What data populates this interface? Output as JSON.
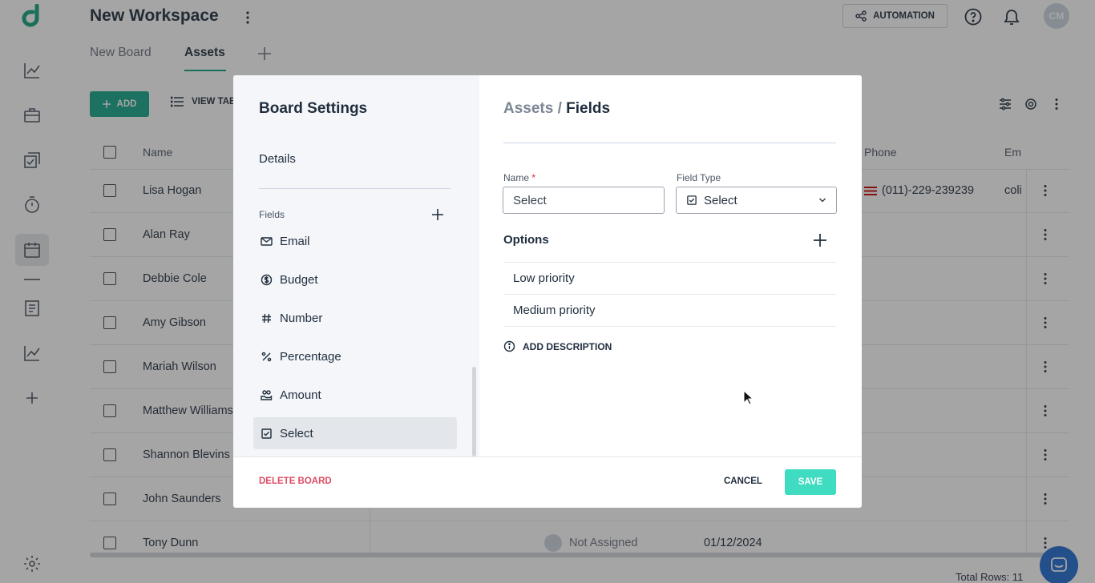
{
  "header": {
    "workspace_title": "New Workspace",
    "automation_label": "AUTOMATION",
    "avatar_initials": "CM"
  },
  "tabs": [
    {
      "label": "New Board",
      "selected": false
    },
    {
      "label": "Assets",
      "selected": true
    }
  ],
  "toolbar": {
    "add_label": "ADD",
    "view_label": "VIEW TAB"
  },
  "table": {
    "columns": [
      "Name",
      "Phone",
      "Em"
    ],
    "rows": [
      {
        "name": "Lisa Hogan",
        "phone": "(011)-229-239239",
        "email": "coli"
      },
      {
        "name": "Alan Ray"
      },
      {
        "name": "Debbie Cole"
      },
      {
        "name": "Amy Gibson"
      },
      {
        "name": "Mariah Wilson"
      },
      {
        "name": "Matthew Williams"
      },
      {
        "name": "Shannon Blevins"
      },
      {
        "name": "John Saunders"
      },
      {
        "name": "Tony Dunn",
        "assignee": "Not Assigned",
        "date": "01/12/2024"
      }
    ],
    "total_rows": "Total Rows: 11"
  },
  "modal": {
    "title": "Board Settings",
    "details_label": "Details",
    "fields_label": "Fields",
    "fields": [
      {
        "label": "Email",
        "icon": "mail-icon"
      },
      {
        "label": "Budget",
        "icon": "dollar-circle-icon"
      },
      {
        "label": "Number",
        "icon": "hash-icon"
      },
      {
        "label": "Percentage",
        "icon": "percent-icon"
      },
      {
        "label": "Amount",
        "icon": "coins-hand-icon"
      },
      {
        "label": "Select",
        "icon": "checkbox-icon",
        "selected": true
      }
    ],
    "crumb_parent": "Assets /",
    "crumb_current": "Fields",
    "name_label": "Name",
    "name_required": "*",
    "name_value": "Select",
    "field_type_label": "Field Type",
    "field_type_value": "Select",
    "options_title": "Options",
    "options": [
      "Low priority",
      "Medium priority"
    ],
    "add_description_label": "ADD DESCRIPTION",
    "delete_label": "DELETE BOARD",
    "cancel_label": "CANCEL",
    "save_label": "SAVE"
  },
  "colors": {
    "accent": "#13a689",
    "save": "#3fdcc1",
    "danger": "#dc4c64",
    "text": "#1f2d3d"
  }
}
